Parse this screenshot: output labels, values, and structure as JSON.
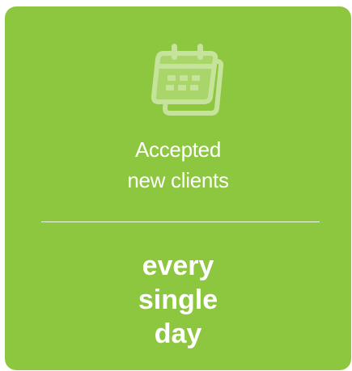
{
  "card": {
    "background": "#8dc63f",
    "icon": "calendar-icon",
    "subtitle_line1": "Accepted",
    "subtitle_line2": "new clients",
    "headline_line1": "every",
    "headline_line2": "single",
    "headline_line3": "day"
  }
}
